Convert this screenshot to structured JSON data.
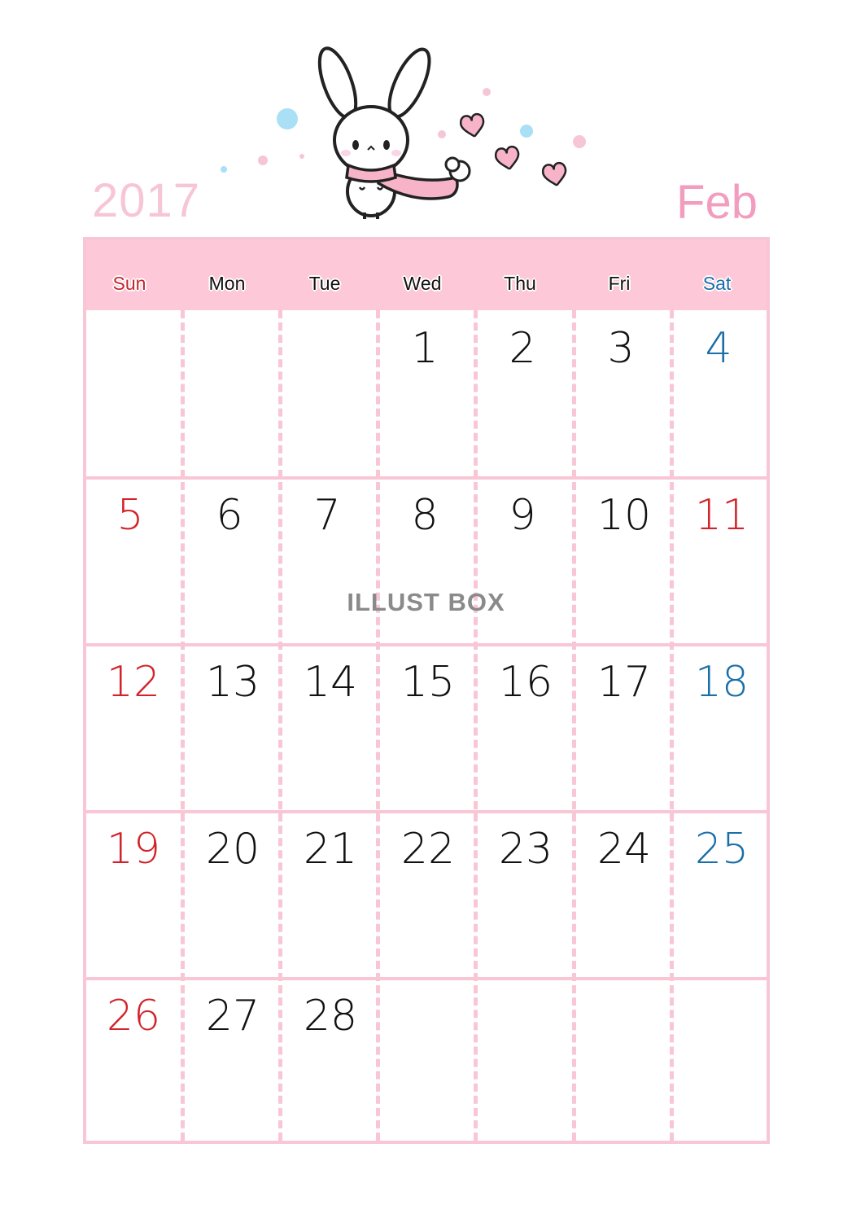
{
  "header": {
    "year": "2017",
    "month": "Feb"
  },
  "illustration": {
    "subject": "bunny-with-pink-scarf",
    "decorations": [
      "heart-icon",
      "heart-icon",
      "heart-icon",
      "dot-pink",
      "dot-blue"
    ]
  },
  "calendar": {
    "weekdays": [
      {
        "label": "Sun",
        "type": "sun"
      },
      {
        "label": "Mon",
        "type": "weekday"
      },
      {
        "label": "Tue",
        "type": "weekday"
      },
      {
        "label": "Wed",
        "type": "weekday"
      },
      {
        "label": "Thu",
        "type": "weekday"
      },
      {
        "label": "Fri",
        "type": "weekday"
      },
      {
        "label": "Sat",
        "type": "sat"
      }
    ],
    "weeks": [
      [
        "",
        "",
        "",
        "1",
        "2",
        "3",
        "4"
      ],
      [
        "5",
        "6",
        "7",
        "8",
        "9",
        "10",
        "11"
      ],
      [
        "12",
        "13",
        "14",
        "15",
        "16",
        "17",
        "18"
      ],
      [
        "19",
        "20",
        "21",
        "22",
        "23",
        "24",
        "25"
      ],
      [
        "26",
        "27",
        "28",
        "",
        "",
        "",
        ""
      ]
    ],
    "holidays": [
      "11"
    ]
  },
  "colors": {
    "sunday_holiday": "#d2232a",
    "saturday": "#1a6fa8",
    "grid_pink": "#f9c6d6",
    "header_pink": "#fdc8d8",
    "year_text": "#f7c6d6",
    "month_text": "#f29dbf"
  },
  "watermark": "ILLUST BOX"
}
